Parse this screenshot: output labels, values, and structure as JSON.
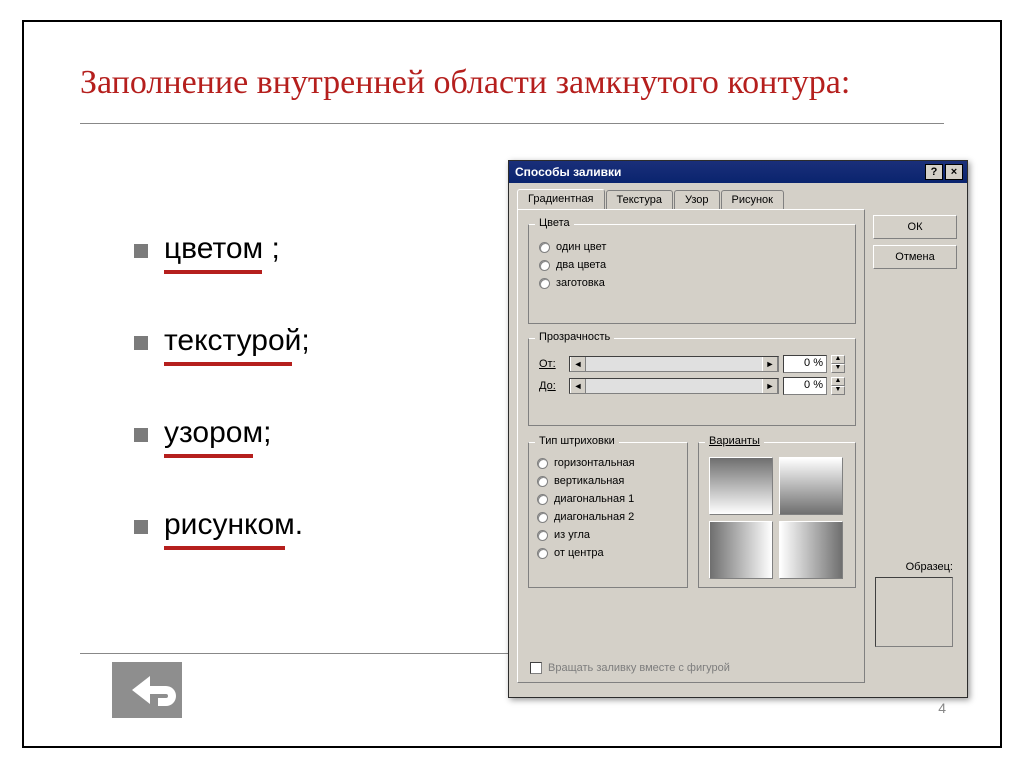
{
  "slide": {
    "title": "Заполнение внутренней области замкнутого контура:",
    "bullets": [
      "цветом ;",
      "текстурой;",
      "узором;",
      "рисунком."
    ],
    "page_number": "4"
  },
  "dialog": {
    "title": "Способы заливки",
    "tabs": [
      "Градиентная",
      "Текстура",
      "Узор",
      "Рисунок"
    ],
    "active_tab": 0,
    "buttons": {
      "ok": "ОК",
      "cancel": "Отмена"
    },
    "colors_group": {
      "legend": "Цвета",
      "options": [
        "один цвет",
        "два цвета",
        "заготовка"
      ]
    },
    "transparency_group": {
      "legend": "Прозрачность",
      "from_label": "От:",
      "to_label": "До:",
      "from_value": "0 %",
      "to_value": "0 %"
    },
    "hatch_group": {
      "legend": "Тип штриховки",
      "options": [
        "горизонтальная",
        "вертикальная",
        "диагональная 1",
        "диагональная 2",
        "из угла",
        "от центра"
      ]
    },
    "variants_group": {
      "legend": "Варианты"
    },
    "sample_label": "Образец:",
    "rotate_checkbox": "Вращать заливку вместе с фигурой"
  }
}
